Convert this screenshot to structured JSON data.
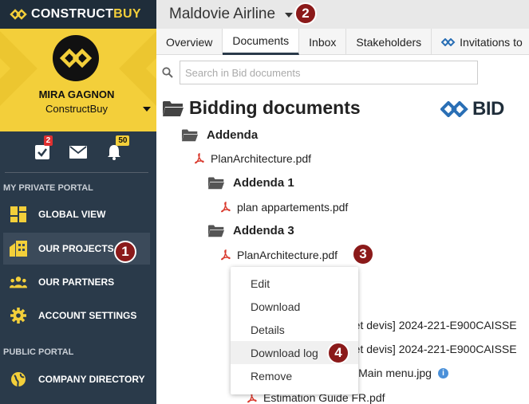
{
  "app": {
    "brand_prefix": "CONSTRUCT",
    "brand_suffix": "BUY",
    "accent": "#f3cf3a",
    "sidebar_bg": "#2a3a4a"
  },
  "profile": {
    "name": "MIRA GAGNON",
    "company": "ConstructBuy"
  },
  "notifications": {
    "tasks_count": "2",
    "alerts_count": "50"
  },
  "sidebar": {
    "private_label": "MY PRIVATE PORTAL",
    "public_label": "PUBLIC PORTAL",
    "items": [
      {
        "label": "GLOBAL VIEW",
        "icon": "dashboard-icon"
      },
      {
        "label": "OUR PROJECTS",
        "icon": "projects-icon"
      },
      {
        "label": "OUR PARTNERS",
        "icon": "partners-icon"
      },
      {
        "label": "ACCOUNT SETTINGS",
        "icon": "gear-icon"
      }
    ],
    "public_items": [
      {
        "label": "COMPANY DIRECTORY",
        "icon": "globe-icon"
      }
    ]
  },
  "steps": [
    "1",
    "2",
    "3",
    "4"
  ],
  "header": {
    "project_title": "Maldovie Airline"
  },
  "tabs": [
    {
      "label": "Overview"
    },
    {
      "label": "Documents"
    },
    {
      "label": "Inbox"
    },
    {
      "label": "Stakeholders"
    },
    {
      "label": "Invitations to"
    }
  ],
  "search": {
    "placeholder": "Search in Bid documents"
  },
  "documents": {
    "heading": "Bidding documents",
    "bid_logo_text": "BID",
    "folder_addenda": "Addenda",
    "file_plan_1": "PlanArchitecture.pdf",
    "folder_addenda_1": "Addenda 1",
    "file_plan_appart": "plan appartements.pdf",
    "folder_addenda_3": "Addenda 3",
    "file_plan_2": "PlanArchitecture.pdf",
    "file_partial_1": "ns et devis] 2024-221-E900CAISSE",
    "file_partial_2": "ns et devis] 2024-221-E900CAISSE",
    "file_partial_3": ".56-Main menu.jpg",
    "file_estimation": "Estimation Guide FR.pdf"
  },
  "context_menu": {
    "items": [
      "Edit",
      "Download",
      "Details",
      "Download log",
      "Remove"
    ]
  }
}
